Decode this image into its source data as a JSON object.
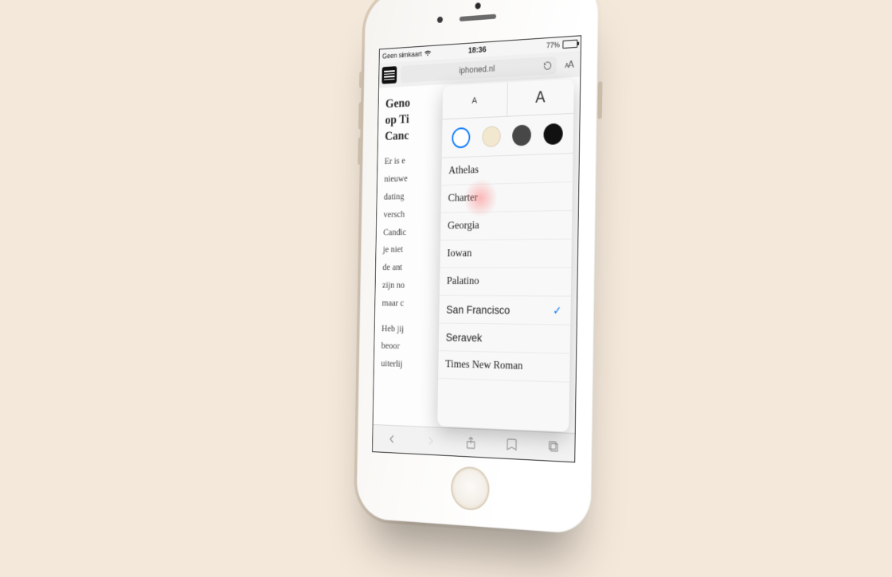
{
  "statusbar": {
    "carrier": "Geen simkaart",
    "time": "18:36",
    "battery_text": "77%"
  },
  "urlbar": {
    "host": "iphoned.nl"
  },
  "article": {
    "headline_line1": "Geno",
    "headline_line2": "op Ti",
    "headline_line3": "Canc",
    "para1": "Er is e\nnieuwe\ndating\nversch\nCandic\nje niet\nde ant\nzijn no\nmaar c",
    "para2": "Heb jij\nbeoor\nuiterlij"
  },
  "popover": {
    "size_small_label": "A",
    "size_large_label": "A",
    "themes": {
      "white": "#ffffff",
      "sepia": "#f2e7cf",
      "gray": "#474747",
      "black": "#111111"
    },
    "fonts": [
      {
        "name": "Athelas",
        "selected": false,
        "sans": false
      },
      {
        "name": "Charter",
        "selected": false,
        "sans": false
      },
      {
        "name": "Georgia",
        "selected": false,
        "sans": false
      },
      {
        "name": "Iowan",
        "selected": false,
        "sans": false
      },
      {
        "name": "Palatino",
        "selected": false,
        "sans": false
      },
      {
        "name": "San Francisco",
        "selected": true,
        "sans": true
      },
      {
        "name": "Seravek",
        "selected": false,
        "sans": true
      },
      {
        "name": "Times New Roman",
        "selected": false,
        "sans": false
      }
    ],
    "checkmark": "✓"
  }
}
